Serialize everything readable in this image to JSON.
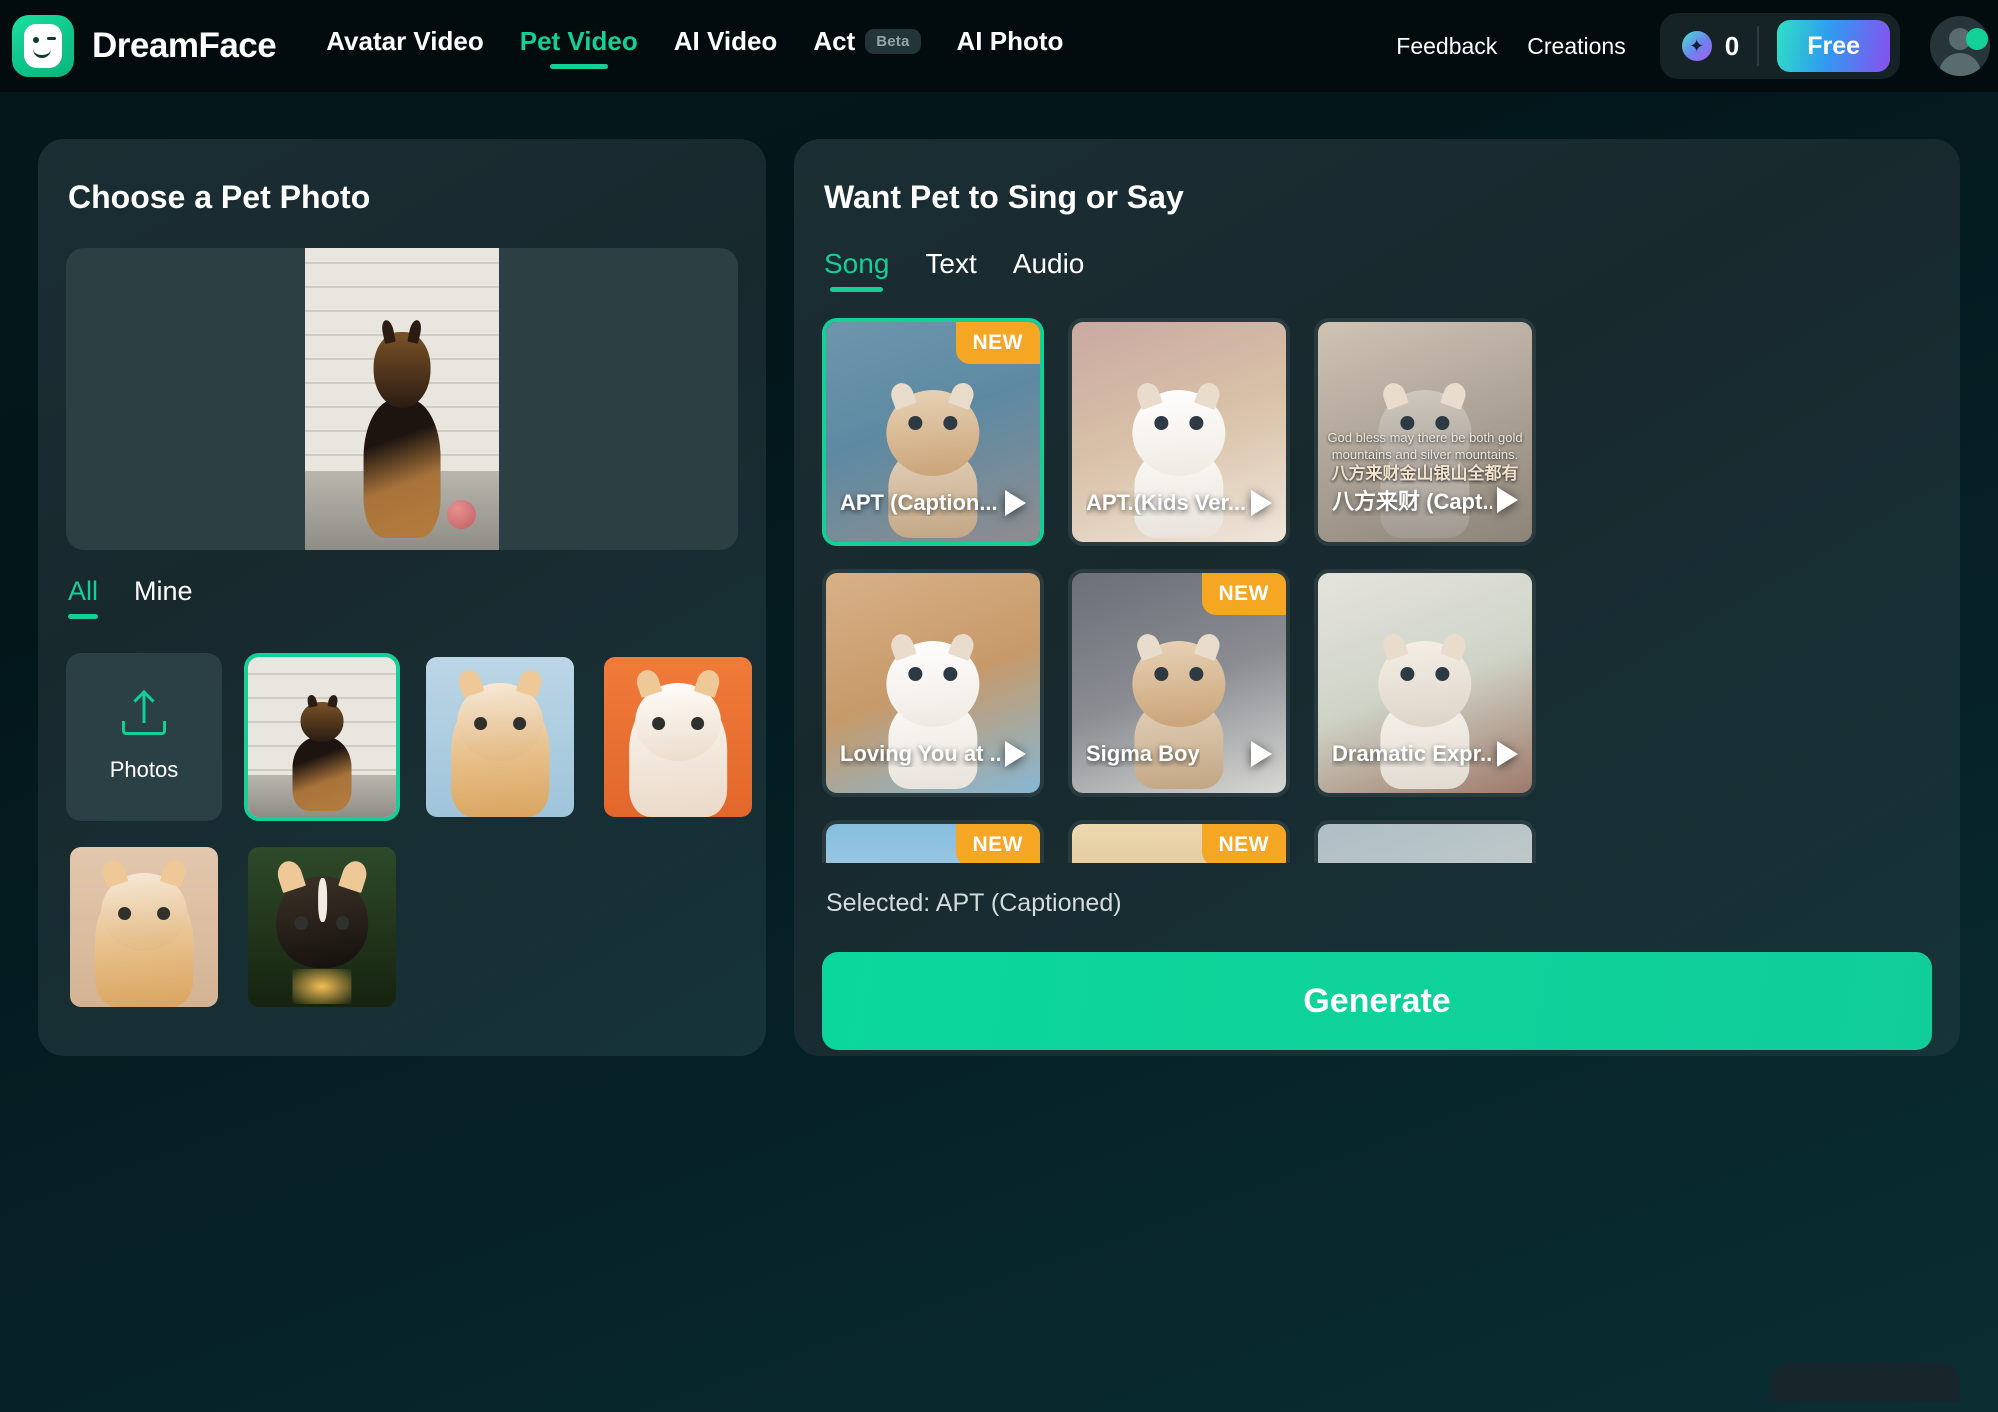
{
  "header": {
    "brand": "DreamFace",
    "logo_icon": "dreamface-logo-icon",
    "nav": [
      {
        "label": "Avatar Video",
        "active": false
      },
      {
        "label": "Pet Video",
        "active": true
      },
      {
        "label": "AI Video",
        "active": false
      },
      {
        "label": "Act",
        "active": false,
        "badge": "Beta"
      },
      {
        "label": "AI Photo",
        "active": false
      }
    ],
    "feedback_label": "Feedback",
    "creations_label": "Creations",
    "credits": {
      "icon": "sparkle-icon",
      "count": "0"
    },
    "free_label": "Free",
    "accent_color": "#14cf96",
    "badge_color": "#f5a623"
  },
  "left_panel": {
    "title": "Choose a Pet Photo",
    "preview_alt": "selected-pet-photo-dog",
    "tabs": [
      {
        "label": "All",
        "active": true
      },
      {
        "label": "Mine",
        "active": false
      }
    ],
    "upload": {
      "icon": "upload-icon",
      "label": "Photos"
    },
    "thumbnails": [
      {
        "name": "pet-thumb-dog-brickwall",
        "selected": true,
        "art": "dog-brick"
      },
      {
        "name": "pet-thumb-cat-blue",
        "selected": false,
        "art": "cat-blue"
      },
      {
        "name": "pet-thumb-cat-orange",
        "selected": false,
        "art": "cat-orange"
      },
      {
        "name": "pet-thumb-cat-tan",
        "selected": false,
        "art": "cat-tan"
      },
      {
        "name": "pet-thumb-puppy-forest",
        "selected": false,
        "art": "dog-forest"
      }
    ]
  },
  "right_panel": {
    "title": "Want Pet to Sing or Say",
    "tabs": [
      {
        "label": "Song",
        "active": true
      },
      {
        "label": "Text",
        "active": false
      },
      {
        "label": "Audio",
        "active": false
      }
    ],
    "songs": [
      {
        "title": "APT (Caption...",
        "badge": "NEW",
        "selected": true,
        "bg": "bg-blue-room",
        "cat": "tabby",
        "captions": []
      },
      {
        "title": "APT.(Kids Ver...",
        "badge": "",
        "selected": false,
        "bg": "bg-cream-bed",
        "cat": "white",
        "captions": []
      },
      {
        "title": "八方来财 (Capt...",
        "badge": "",
        "selected": false,
        "bg": "bg-grey-cat",
        "cat": "grey",
        "captions": [
          "God bless may there be both gold",
          "mountains and silver mountains."
        ],
        "caption_cn": "八方来财金山银山全都有"
      },
      {
        "title": "Loving You at ...",
        "badge": "",
        "selected": false,
        "bg": "bg-street",
        "cat": "white",
        "captions": []
      },
      {
        "title": "Sigma Boy",
        "badge": "NEW",
        "selected": false,
        "bg": "bg-window",
        "cat": "tabby",
        "captions": []
      },
      {
        "title": "Dramatic Expr...",
        "badge": "",
        "selected": false,
        "bg": "bg-balcony",
        "cat": "dog",
        "captions": []
      },
      {
        "title": "",
        "badge": "NEW",
        "selected": false,
        "bg": "bg-harbor",
        "cat": "tabby",
        "captions": []
      },
      {
        "title": "",
        "badge": "NEW",
        "selected": false,
        "bg": "bg-temple",
        "cat": "chi",
        "captions": []
      },
      {
        "title": "",
        "badge": "",
        "selected": false,
        "bg": "bg-plain",
        "cat": "tabby",
        "captions": []
      }
    ],
    "selected_label": "Selected: APT (Captioned)",
    "generate_label": "Generate"
  }
}
